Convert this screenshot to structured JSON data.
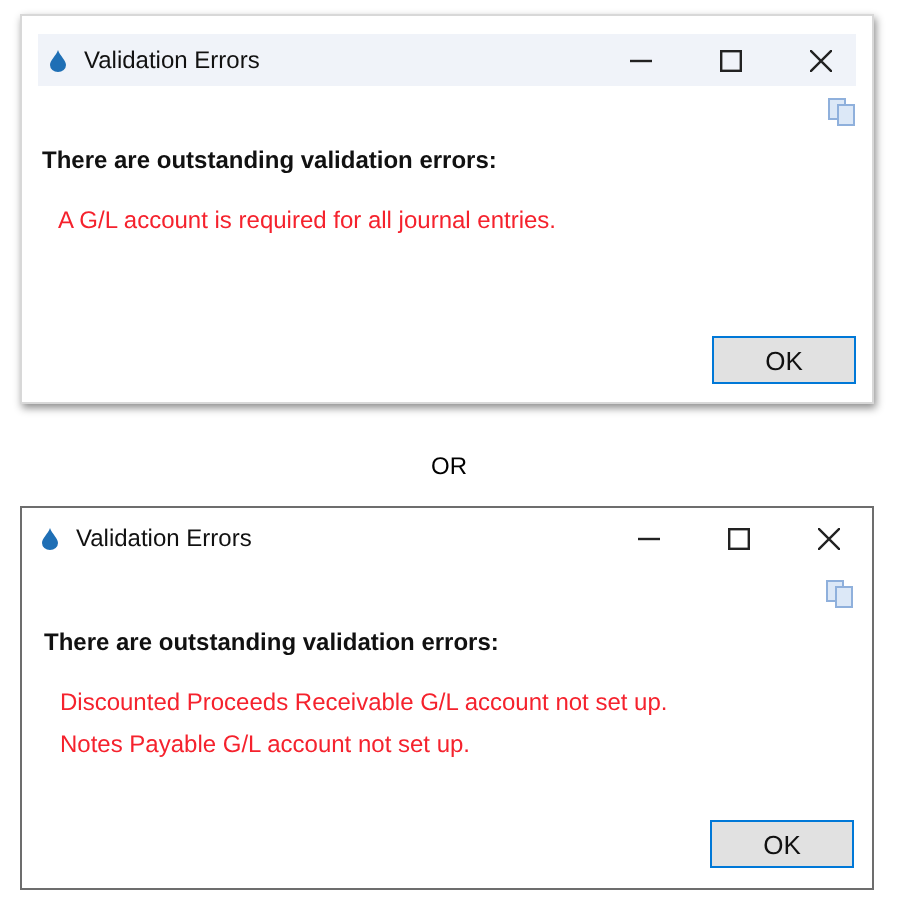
{
  "dialogs": [
    {
      "kind": "shadowed",
      "title": "Validation Errors",
      "heading": "There are outstanding validation errors:",
      "errors": [
        "A G/L account is required for all journal entries."
      ],
      "button": "OK"
    },
    {
      "kind": "bordered",
      "title": "Validation Errors",
      "heading": "There are outstanding validation errors:",
      "errors": [
        "Discounted Proceeds Receivable G/L account not set up.",
        "Notes Payable G/L account not set up."
      ],
      "button": "OK"
    }
  ],
  "separator": "OR"
}
